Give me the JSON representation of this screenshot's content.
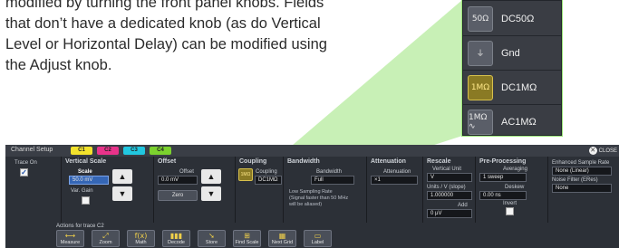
{
  "intro": {
    "line1": "modified by turning the front panel knobs. Fields",
    "line2": "that don’t have a dedicated knob (as do Vertical",
    "line3": "Level or Horizontal Delay) can be modified using",
    "line4": "the Adjust knob."
  },
  "coupling_menu": {
    "options": [
      {
        "icon_text": "50Ω",
        "label": "DC50Ω",
        "selected": false
      },
      {
        "icon_text": "⏚",
        "label": "Gnd",
        "selected": false
      },
      {
        "icon_text": "1MΩ",
        "label": "DC1MΩ",
        "selected": true
      },
      {
        "icon_text": "1MΩ ∿",
        "label": "AC1MΩ",
        "selected": false
      }
    ]
  },
  "dialog": {
    "title": "Channel Setup",
    "tabs": [
      {
        "label": "C1",
        "color": "#f2e22c"
      },
      {
        "label": "C2",
        "color": "#e8338a"
      },
      {
        "label": "C3",
        "color": "#21c7e0"
      },
      {
        "label": "C4",
        "color": "#7bd12e"
      }
    ],
    "close_label": "CLOSE",
    "trace_on": {
      "label": "Trace On",
      "checked": true
    },
    "vertical_scale": {
      "header": "Vertical Scale",
      "scale_label": "Scale",
      "scale_value": "50.0 mV",
      "var_gain_label": "Var. Gain"
    },
    "offset": {
      "header": "Offset",
      "offset_label": "Offset",
      "offset_value": "0.0 mV",
      "zero_label": "Zero"
    },
    "coupling": {
      "header": "Coupling",
      "coupling_label": "Coupling",
      "coupling_value": "DC1MΩ",
      "icon_text": "1MΩ"
    },
    "bandwidth": {
      "header": "Bandwidth",
      "bandwidth_label": "Bandwidth",
      "bandwidth_value": "Full",
      "note1": "Low Sampling Rate",
      "note2": "(Signal faster than 50 MHz",
      "note3": "will be aliased)"
    },
    "attenuation": {
      "header": "Attenuation",
      "attenuation_label": "Attenuation",
      "attenuation_value": "×1"
    },
    "rescale": {
      "header": "Rescale",
      "vertical_unit_label": "Vertical Unit",
      "vertical_unit_value": "V",
      "units_label": "Units / V (slope)",
      "units_value": "1.000000",
      "add_label": "Add",
      "add_value": "0 µV"
    },
    "preprocessing": {
      "header": "Pre-Processing",
      "averaging_label": "Averaging",
      "averaging_value": "1 sweep",
      "deskew_label": "Deskew",
      "deskew_value": "0.00 ns",
      "invert_label": "Invert"
    },
    "enhanced": {
      "sample_rate_label": "Enhanced Sample Rate",
      "sample_rate_value": "None (Linear)",
      "noise_filter_label": "Noise Filter (ERes)",
      "noise_filter_value": "None"
    },
    "actions": {
      "title": "Actions for trace C2",
      "buttons": [
        {
          "label": "Measure",
          "icon": "ruler-icon"
        },
        {
          "label": "Zoom",
          "icon": "zoom-icon"
        },
        {
          "label": "Math",
          "icon": "math-icon"
        },
        {
          "label": "Decode",
          "icon": "decode-icon"
        },
        {
          "label": "Store",
          "icon": "store-icon"
        },
        {
          "label": "Find Scale",
          "icon": "find-scale-icon"
        },
        {
          "label": "Next Grid",
          "icon": "next-grid-icon"
        },
        {
          "label": "Label",
          "icon": "label-icon"
        }
      ]
    }
  },
  "colors": {
    "beam": "#9be37a",
    "selection": "#3566b5",
    "coupling_highlight": "#d7c04c"
  }
}
